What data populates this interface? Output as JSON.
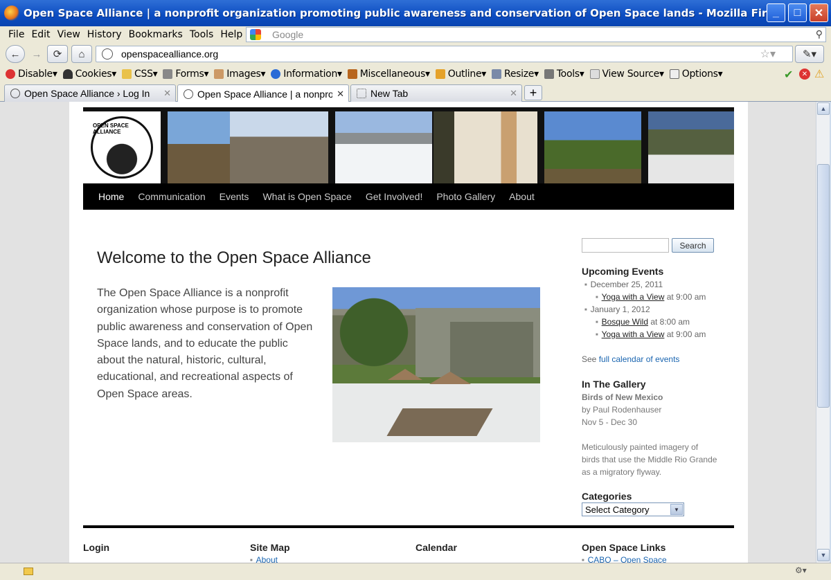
{
  "window": {
    "title": "Open Space Alliance | a nonprofit organization promoting public awareness and conservation of Open Space lands - Mozilla Firefox",
    "min": "_",
    "max": "□",
    "close": "✕"
  },
  "menu": [
    "File",
    "Edit",
    "View",
    "History",
    "Bookmarks",
    "Tools",
    "Help"
  ],
  "search_box": {
    "placeholder": "Google"
  },
  "address": {
    "url": "openspacealliance.org"
  },
  "dev_toolbar": [
    "Disable▾",
    "Cookies▾",
    "CSS▾",
    "Forms▾",
    "Images▾",
    "Information▾",
    "Miscellaneous▾",
    "Outline▾",
    "Resize▾",
    "Tools▾",
    "View Source▾",
    "Options▾"
  ],
  "tabs": [
    {
      "label": "Open Space Alliance › Log In"
    },
    {
      "label": "Open Space Alliance | a nonprofi…"
    },
    {
      "label": "New Tab"
    }
  ],
  "site": {
    "logo_text": "OPEN SPACE ALLIANCE",
    "nav": [
      "Home",
      "Communication",
      "Events",
      "What is Open Space",
      "Get Involved!",
      "Photo Gallery",
      "About"
    ],
    "heading": "Welcome to the Open Space Alliance",
    "intro": "The Open Space Alliance is a nonprofit organization whose purpose is to promote public awareness and conservation of Open Space lands, and to educate the public about the natural, historic, cultural, educational, and recreational aspects of Open Space areas.",
    "search_button": "Search",
    "upcoming": {
      "title": "Upcoming Events",
      "date1": "December 25, 2011",
      "ev1": "Yoga with a View",
      "ev1_time": " at 9:00 am",
      "date2": "January 1, 2012",
      "ev2": "Bosque Wild",
      "ev2_time": " at 8:00 am",
      "ev3": "Yoga with a View",
      "ev3_time": " at 9:00 am",
      "see": "See ",
      "see_link": "full calendar of events"
    },
    "gallery": {
      "title": "In The Gallery",
      "name": "Birds of New Mexico",
      "by": "by Paul Rodenhauser",
      "dates": "Nov 5 - Dec 30",
      "desc1": "Meticulously painted imagery of",
      "desc2": "birds that use the Middle Rio Grande",
      "desc3": "as a migratory flyway."
    },
    "categories": {
      "title": "Categories",
      "selected": "Select Category"
    },
    "footer": {
      "login": "Login",
      "sitemap": "Site Map",
      "sitemap_link": "About",
      "calendar": "Calendar",
      "links": "Open Space Links",
      "links_first": "CABQ – Open Space"
    }
  }
}
